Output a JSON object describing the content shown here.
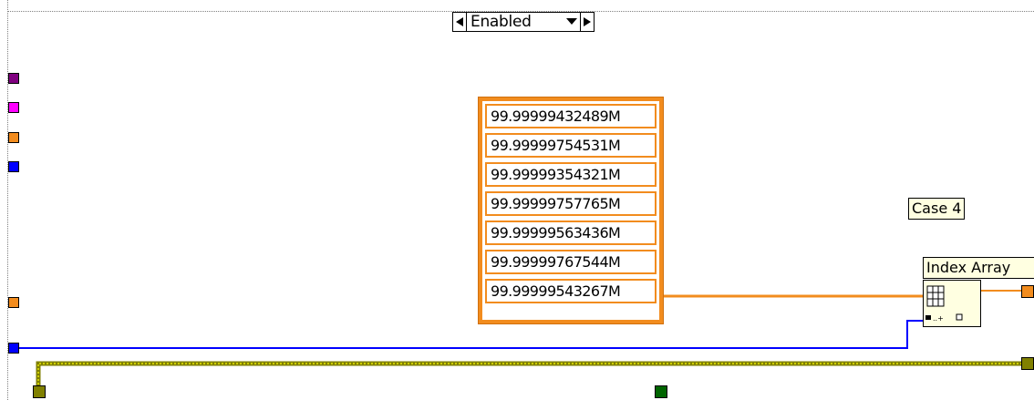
{
  "case_selector": {
    "value": "Enabled"
  },
  "array_constant": {
    "items": [
      "99.99999432489M",
      "99.99999754531M",
      "99.99999354321M",
      "99.99999757765M",
      "99.99999563436M",
      "99.99999767544M",
      "99.99999543267M"
    ]
  },
  "labels": {
    "case_label": "Case 4",
    "index_array_label": "Index Array"
  },
  "colors": {
    "orange": "#f28c1e",
    "blue": "#0000ff",
    "purple": "#800080",
    "magenta": "#ff00ff",
    "olive": "#808000",
    "dark_green": "#006400",
    "yellow": "#e8e800"
  },
  "icons": {
    "index_array": "index-array-icon"
  }
}
